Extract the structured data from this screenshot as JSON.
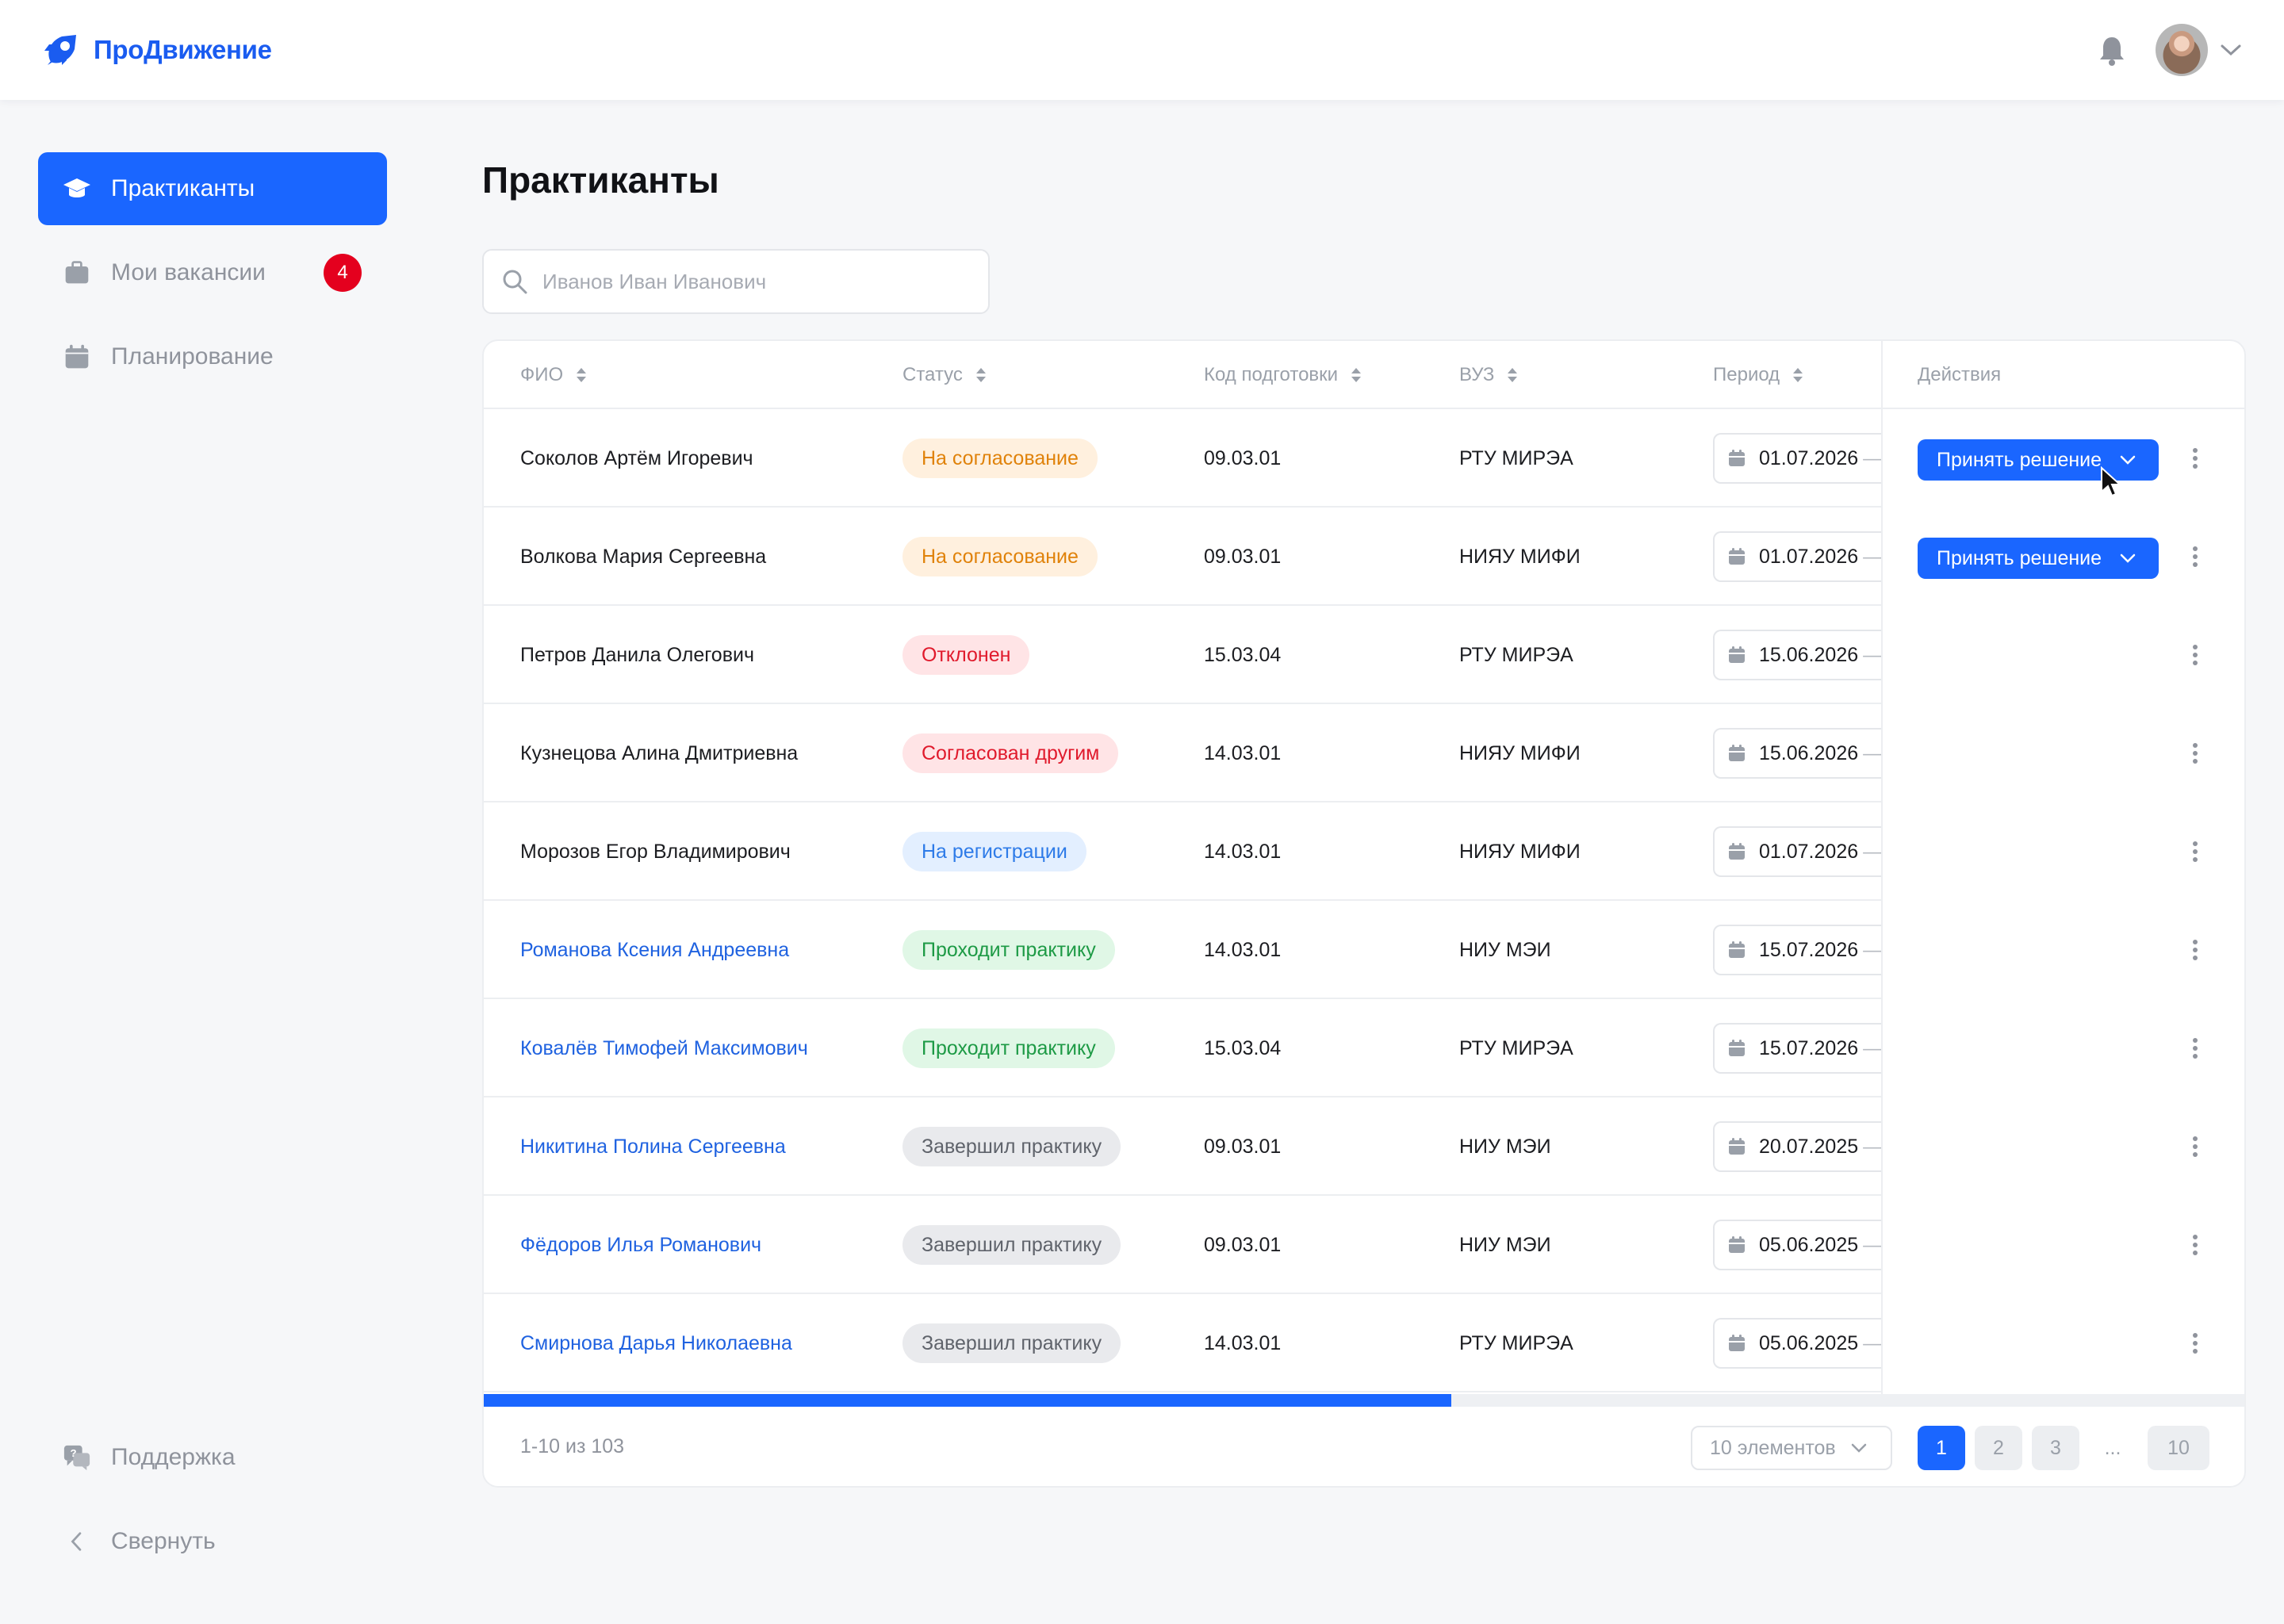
{
  "app": {
    "logo_text": "ПроДвижение"
  },
  "sidebar": {
    "items": [
      {
        "label": "Практиканты"
      },
      {
        "label": "Мои вакансии",
        "badge": "4"
      },
      {
        "label": "Планирование"
      }
    ],
    "support_label": "Поддержка",
    "collapse_label": "Свернуть"
  },
  "main": {
    "title": "Практиканты",
    "search_placeholder": "Иванов Иван Иванович"
  },
  "table": {
    "headers": {
      "fio": "ФИО",
      "status": "Статус",
      "code": "Код подготовки",
      "vuz": "ВУЗ",
      "period": "Период",
      "actions": "Действия"
    },
    "decision_label": "Принять решение",
    "rows": [
      {
        "name": "Соколов Артём Игоревич",
        "status": "На согласование",
        "code": "09.03.01",
        "vuz": "РТУ МИРЭА",
        "date": "01.07.2026"
      },
      {
        "name": "Волкова Мария Сергеевна",
        "status": "На согласование",
        "code": "09.03.01",
        "vuz": "НИЯУ МИФИ",
        "date": "01.07.2026"
      },
      {
        "name": "Петров Данила Олегович",
        "status": "Отклонен",
        "code": "15.03.04",
        "vuz": "РТУ МИРЭА",
        "date": "15.06.2026"
      },
      {
        "name": "Кузнецова Алина Дмитриевна",
        "status": "Согласован другим",
        "code": "14.03.01",
        "vuz": "НИЯУ МИФИ",
        "date": "15.06.2026"
      },
      {
        "name": "Морозов Егор Владимирович",
        "status": "На регистрации",
        "code": "14.03.01",
        "vuz": "НИЯУ МИФИ",
        "date": "01.07.2026"
      },
      {
        "name": "Романова Ксения Андреевна",
        "status": "Проходит практику",
        "code": "14.03.01",
        "vuz": "НИУ МЭИ",
        "date": "15.07.2026"
      },
      {
        "name": "Ковалёв Тимофей Максимович",
        "status": "Проходит практику",
        "code": "15.03.04",
        "vuz": "РТУ МИРЭА",
        "date": "15.07.2026"
      },
      {
        "name": "Никитина Полина Сергеевна",
        "status": "Завершил практику",
        "code": "09.03.01",
        "vuz": "НИУ МЭИ",
        "date": "20.07.2025"
      },
      {
        "name": "Фёдоров Илья Романович",
        "status": "Завершил практику",
        "code": "09.03.01",
        "vuz": "НИУ МЭИ",
        "date": "05.06.2025"
      },
      {
        "name": "Смирнова Дарья Николаевна",
        "status": "Завершил практику",
        "code": "14.03.01",
        "vuz": "РТУ МИРЭА",
        "date": "05.06.2025"
      }
    ],
    "period_dash": "—"
  },
  "footer": {
    "count": "1-10 из 103",
    "page_size": "10 элементов",
    "pages": [
      "1",
      "2",
      "3",
      "...",
      "10"
    ]
  },
  "colors": {
    "accent": "#1a66ff",
    "link": "#1f62e0",
    "badge": "#e4001e"
  }
}
